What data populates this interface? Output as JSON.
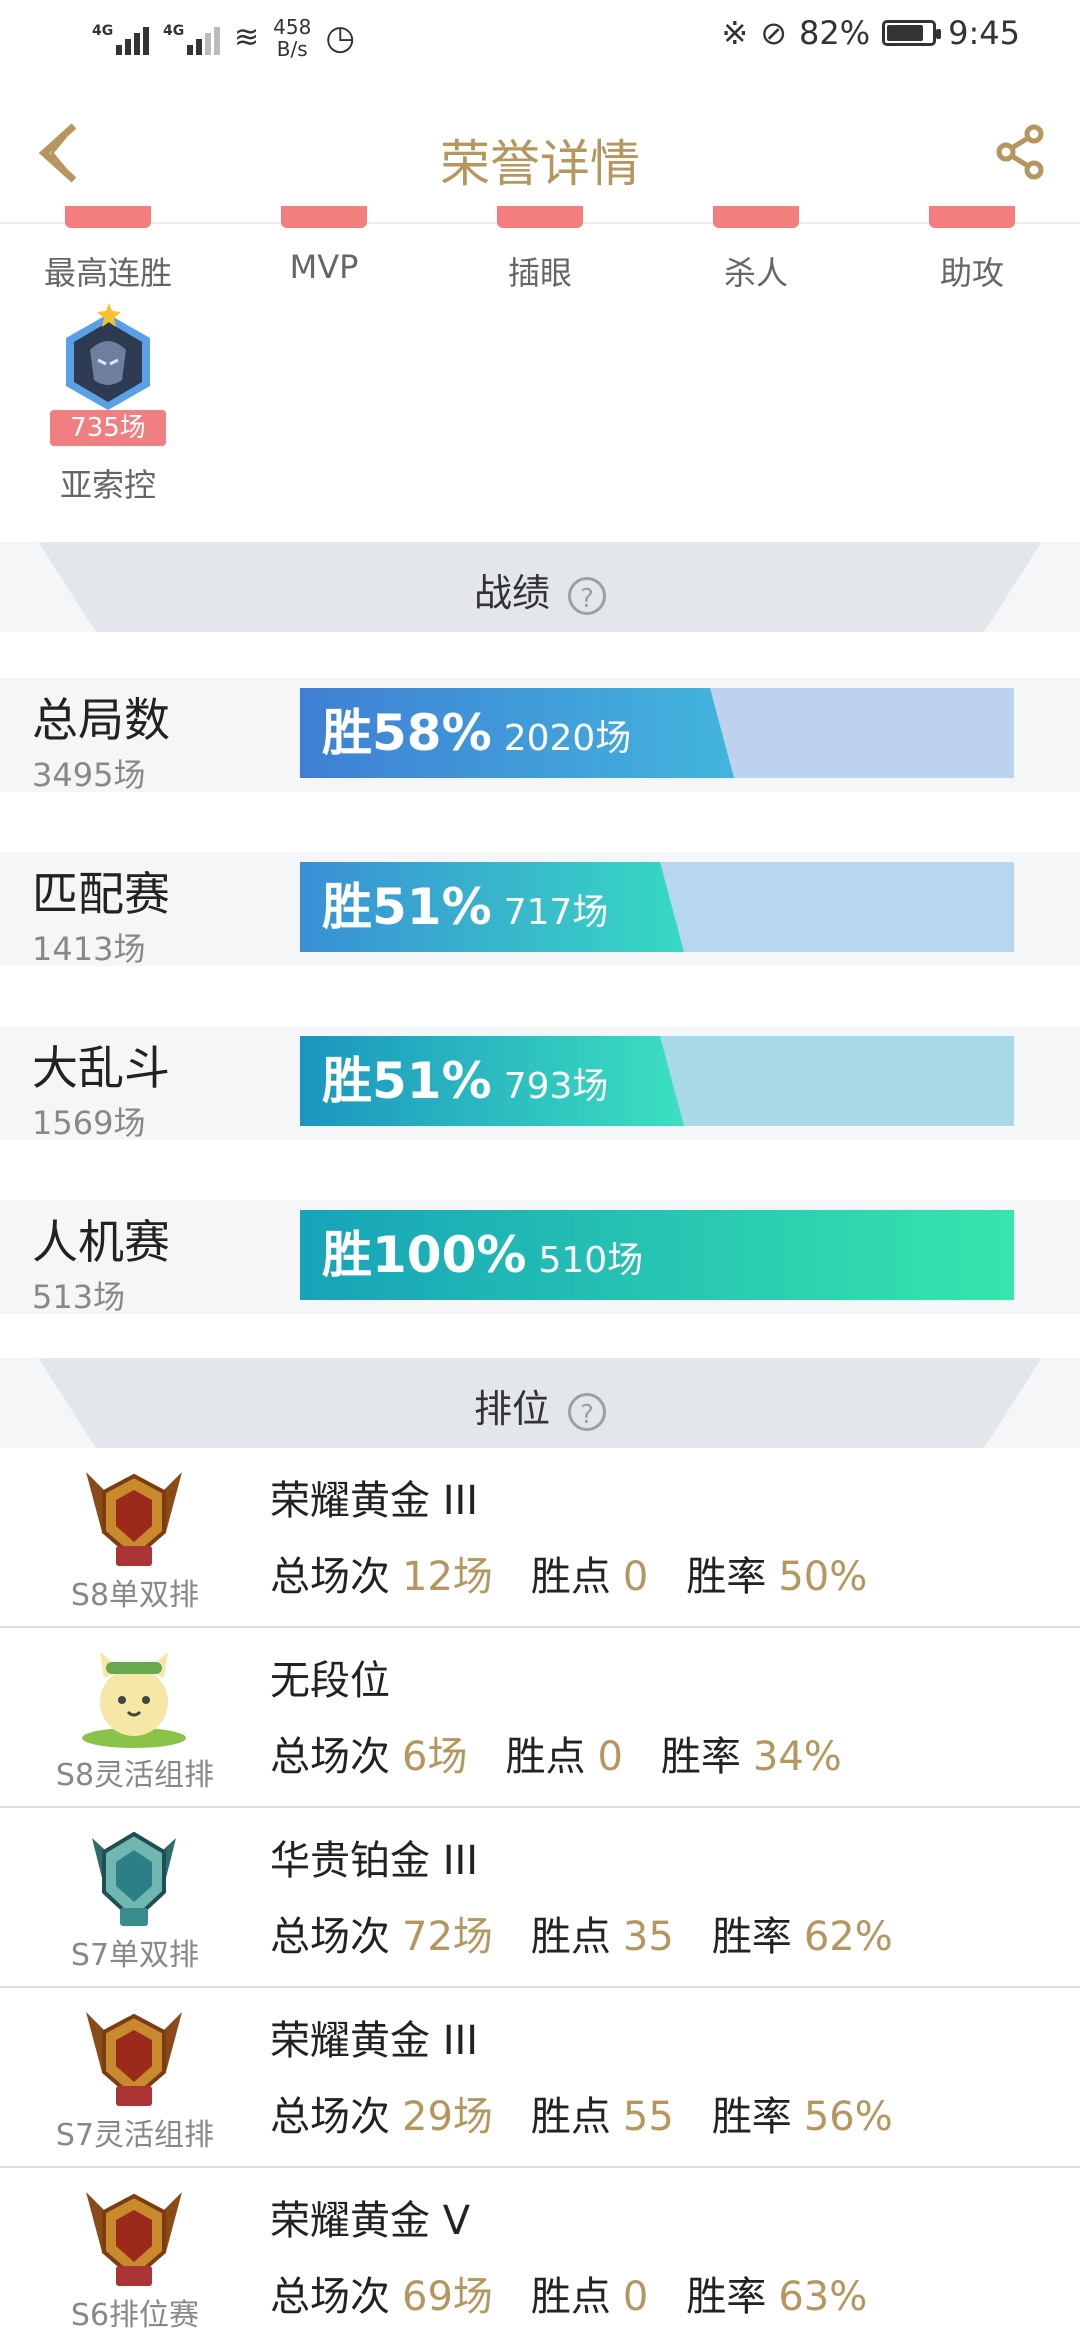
{
  "status_bar": {
    "net1": "4G",
    "net2": "4G",
    "speed_value": "458",
    "speed_unit": "B/s",
    "battery": "82%",
    "battery_level": 0.82,
    "time": "9:45"
  },
  "header": {
    "title": "荣誉详情",
    "back_icon": "chevron-left-icon",
    "share_icon": "share-icon",
    "accent_color": "#b4965e"
  },
  "honors": [
    {
      "label": "最高连胜"
    },
    {
      "label": "MVP"
    },
    {
      "label": "插眼"
    },
    {
      "label": "杀人"
    },
    {
      "label": "助攻"
    }
  ],
  "favorite_hero": {
    "games": "735场",
    "name": "亚索控"
  },
  "record_section": {
    "title": "战绩",
    "help": "?"
  },
  "records": [
    {
      "name": "总局数",
      "total": "3495场",
      "win_pct_label": "胜58%",
      "wins": "2020场",
      "win_rate": 0.58,
      "colors": [
        "#3f7fd4",
        "#42b5dd"
      ],
      "track": "#bdd2ee"
    },
    {
      "name": "匹配赛",
      "total": "1413场",
      "win_pct_label": "胜51%",
      "wins": "717场",
      "win_rate": 0.51,
      "colors": [
        "#3a8fd6",
        "#36d9c3"
      ],
      "track": "#b7d6ef"
    },
    {
      "name": "大乱斗",
      "total": "1569场",
      "win_pct_label": "胜51%",
      "wins": "793场",
      "win_rate": 0.51,
      "colors": [
        "#1a95c0",
        "#3ce0c0"
      ],
      "track": "#a9d9e6"
    },
    {
      "name": "人机赛",
      "total": "513场",
      "win_pct_label": "胜100%",
      "wins": "510场",
      "win_rate": 1.0,
      "colors": [
        "#17a3b8",
        "#36e6ac"
      ],
      "track": "#a9e6d6"
    }
  ],
  "rank_section": {
    "title": "排位",
    "help": "?"
  },
  "rank_labels": {
    "games": "总场次",
    "points": "胜点",
    "rate": "胜率"
  },
  "ranks": [
    {
      "season": "S8单双排",
      "tier": "荣耀黄金 III",
      "games": "12场",
      "points": "0",
      "rate": "50%",
      "icon": "gold-rank-icon"
    },
    {
      "season": "S8灵活组排",
      "tier": "无段位",
      "games": "6场",
      "points": "0",
      "rate": "34%",
      "icon": "unranked-cat-icon"
    },
    {
      "season": "S7单双排",
      "tier": "华贵铂金 III",
      "games": "72场",
      "points": "35",
      "rate": "62%",
      "icon": "platinum-rank-icon"
    },
    {
      "season": "S7灵活组排",
      "tier": "荣耀黄金 III",
      "games": "29场",
      "points": "55",
      "rate": "56%",
      "icon": "gold-rank-icon"
    },
    {
      "season": "S6排位赛",
      "tier": "荣耀黄金 V",
      "games": "69场",
      "points": "0",
      "rate": "63%",
      "icon": "gold-rank-icon"
    }
  ]
}
